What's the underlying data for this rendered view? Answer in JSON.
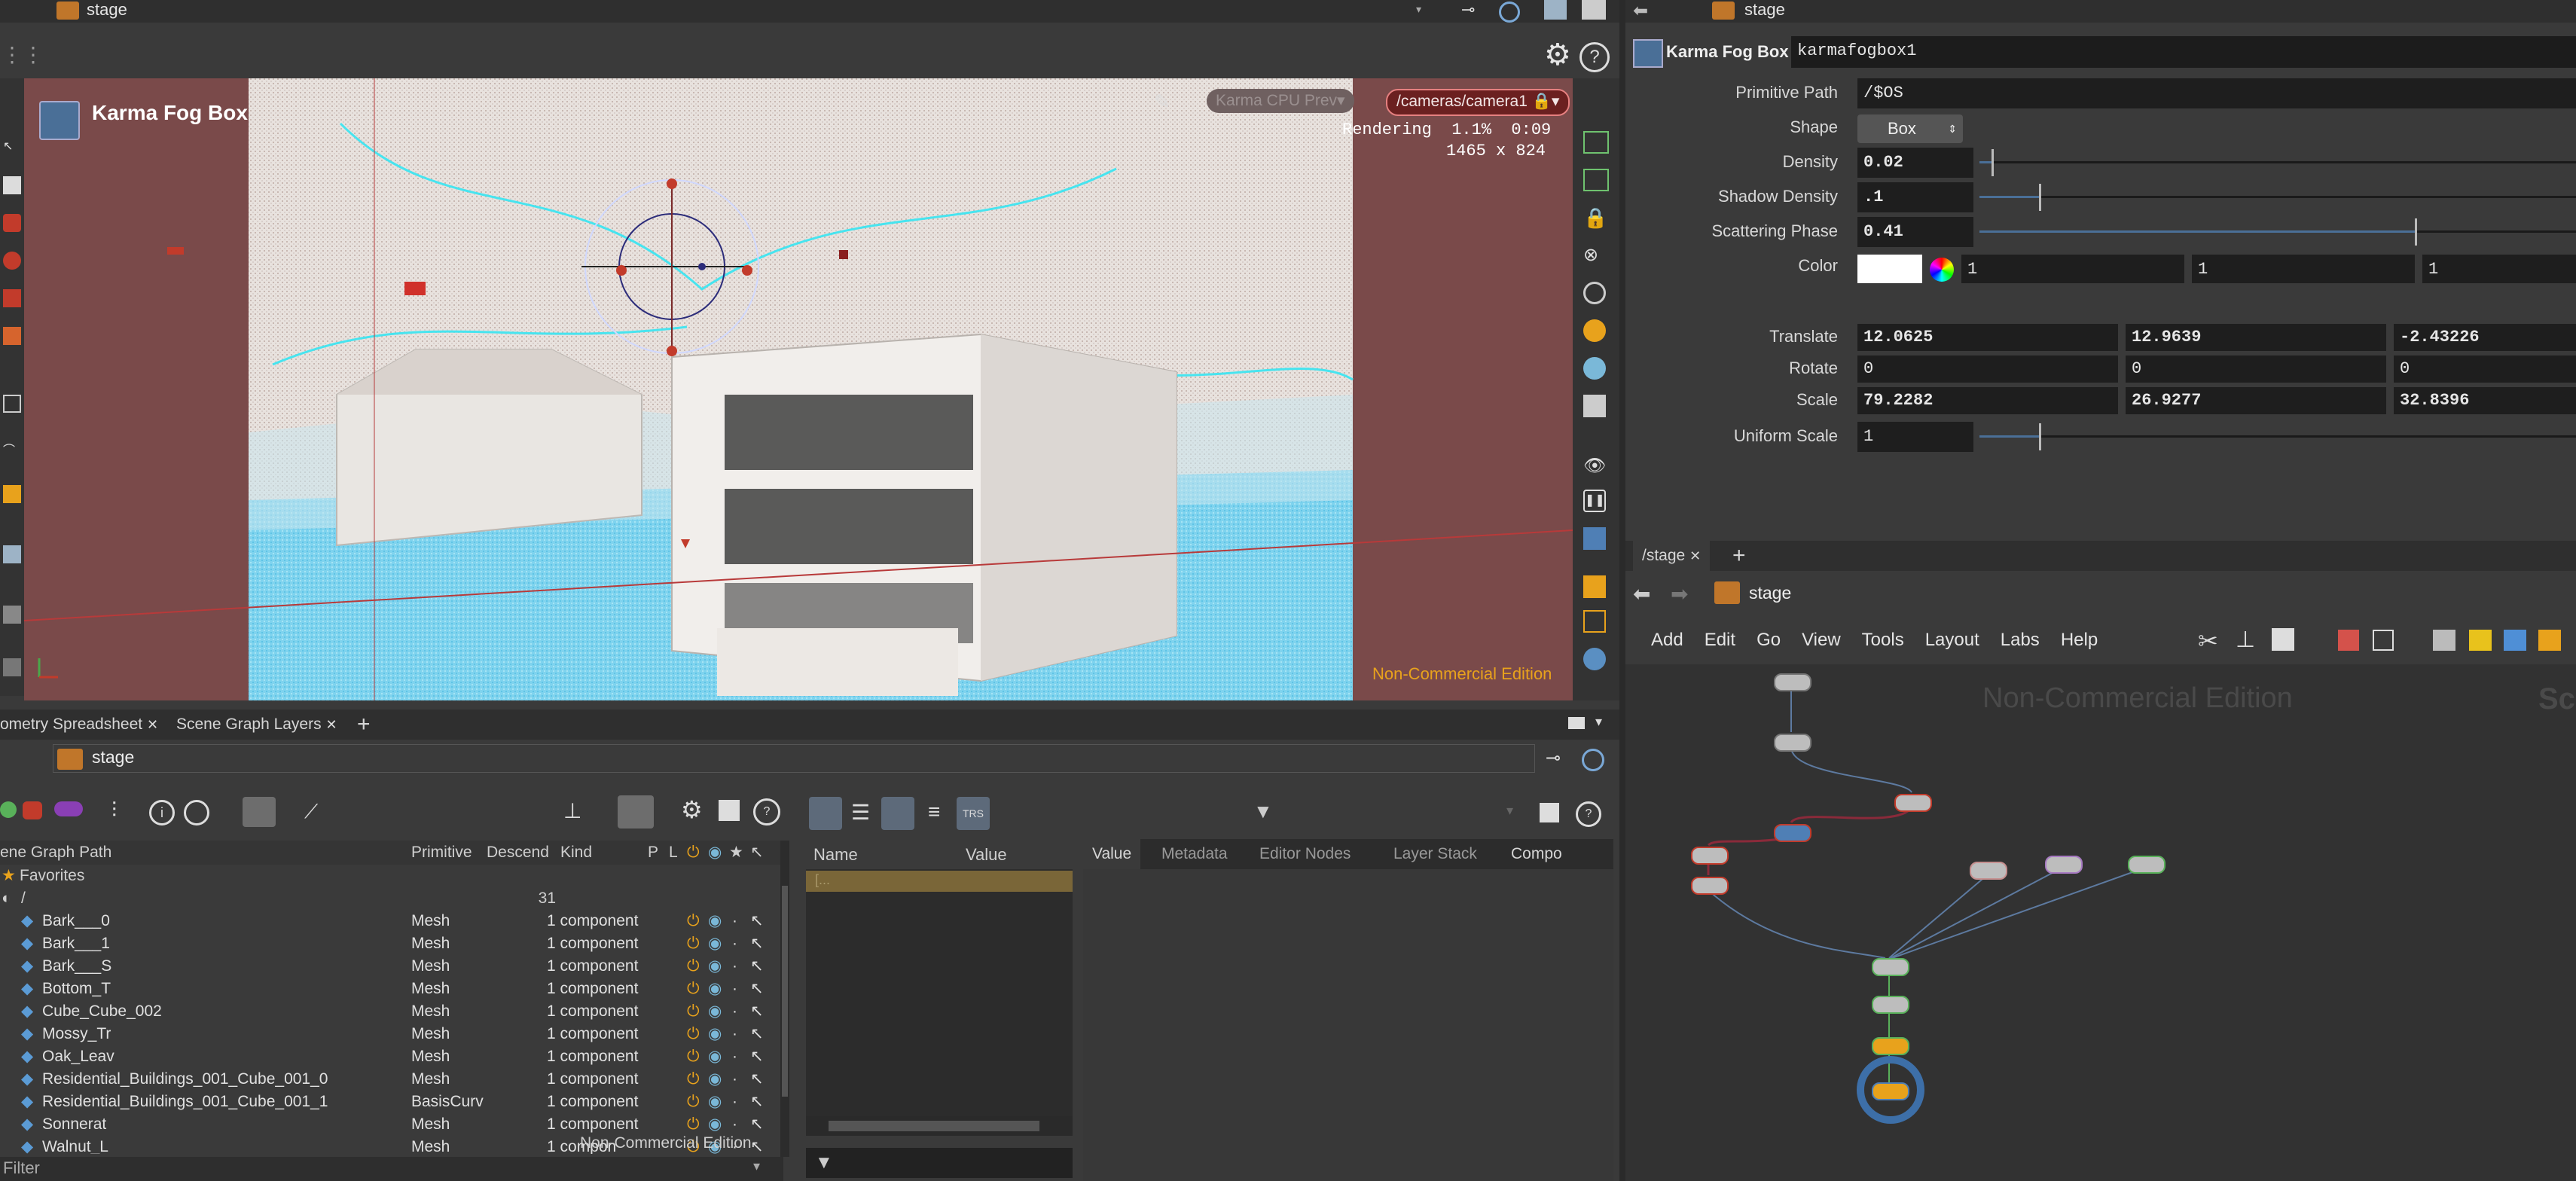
{
  "top_path": {
    "left": "stage",
    "right": "stage"
  },
  "viewport": {
    "node_title": "Karma Fog Box",
    "renderer": "Karma CPU Prev",
    "camera": "/cameras/camera1",
    "status_line1": "Rendering  1.1%  0:09",
    "status_line2": "1465 x 824",
    "watermark": "Non-Commercial Edition"
  },
  "params": {
    "type_label": "Karma Fog Box",
    "node_name": "karmafogbox1",
    "rows": [
      {
        "label": "Primitive Path",
        "value": "/$OS"
      },
      {
        "label": "Shape",
        "value": "Box"
      },
      {
        "label": "Density",
        "value": "0.02",
        "slider": 0.02
      },
      {
        "label": "Shadow Density",
        "value": ".1",
        "slider": 0.1
      },
      {
        "label": "Scattering Phase",
        "value": "0.41",
        "slider": 0.73
      },
      {
        "label": "Color",
        "c1": "1",
        "c2": "1",
        "c3": "1"
      }
    ],
    "xform": [
      {
        "label": "Translate",
        "x": "12.0625",
        "y": "12.9639",
        "z": "-2.43226"
      },
      {
        "label": "Rotate",
        "x": "0",
        "y": "0",
        "z": "0"
      },
      {
        "label": "Scale",
        "x": "79.2282",
        "y": "26.9277",
        "z": "32.8396"
      }
    ],
    "uniform_scale": {
      "label": "Uniform Scale",
      "value": "1",
      "slider": 0.1
    }
  },
  "network": {
    "tab": "/stage",
    "path": "stage",
    "menu": [
      "Add",
      "Edit",
      "Go",
      "View",
      "Tools",
      "Layout",
      "Labs",
      "Help"
    ],
    "watermark": "Non-Commercial Edition",
    "watermark_right": "Sc"
  },
  "spreadsheet": {
    "tabs": [
      "ometry Spreadsheet",
      "Scene Graph Layers"
    ],
    "path": "stage",
    "columns": [
      "ene Graph Path",
      "Primitive",
      "Descend",
      "Kind",
      "P",
      "L"
    ],
    "favorites": "Favorites",
    "root": {
      "path": "/",
      "count": "31"
    },
    "rows": [
      {
        "name": "Bark___0",
        "prim": "Mesh",
        "kind": "1 component"
      },
      {
        "name": "Bark___1",
        "prim": "Mesh",
        "kind": "1 component"
      },
      {
        "name": "Bark___S",
        "prim": "Mesh",
        "kind": "1 component"
      },
      {
        "name": "Bottom_T",
        "prim": "Mesh",
        "kind": "1 component"
      },
      {
        "name": "Cube_Cube_002",
        "prim": "Mesh",
        "kind": "1 component"
      },
      {
        "name": "Mossy_Tr",
        "prim": "Mesh",
        "kind": "1 component"
      },
      {
        "name": "Oak_Leav",
        "prim": "Mesh",
        "kind": "1 component"
      },
      {
        "name": "Residential_Buildings_001_Cube_001_0",
        "prim": "Mesh",
        "kind": "1 component"
      },
      {
        "name": "Residential_Buildings_001_Cube_001_1",
        "prim": "BasisCurv",
        "kind": "1 component"
      },
      {
        "name": "Sonnerat",
        "prim": "Mesh",
        "kind": "1 component"
      },
      {
        "name": "Walnut_L",
        "prim": "Mesh",
        "kind": "1 compon"
      }
    ],
    "filter": "Filter",
    "watermark": "Non-Commercial Edition"
  },
  "layers": {
    "columns": [
      "Name",
      "Value"
    ],
    "first_row": "[...",
    "tabs": [
      "Value",
      "Metadata",
      "Editor Nodes",
      "Layer Stack",
      "Compo"
    ]
  },
  "colors": {
    "accent_orange": "#e8a21c",
    "cyan": "#47e4ef",
    "selection_blue": "#4a8ab8"
  }
}
